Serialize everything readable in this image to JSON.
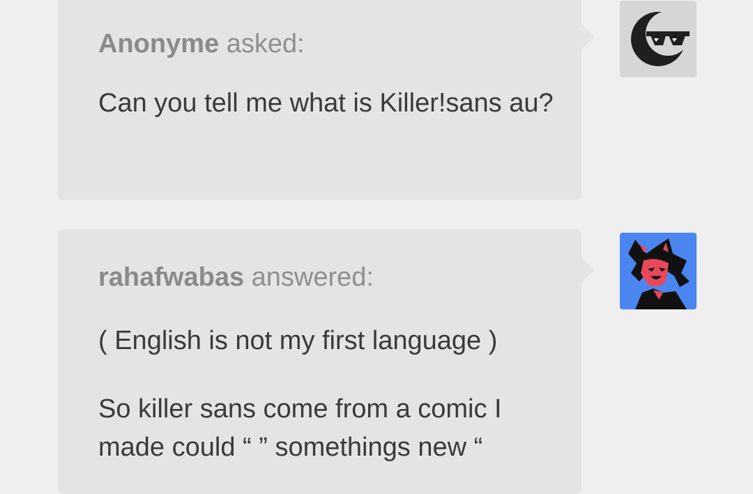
{
  "ask": {
    "asker_name": "Anonyme",
    "verb": "asked:",
    "question": "Can you tell me what is Killer!sans au?",
    "avatar_icon": "sunglasses-moon-icon"
  },
  "answer": {
    "answerer_name": "rahafwabas",
    "verb": "answered:",
    "paragraphs": [
      "( English is not my first language )",
      "So killer sans come from a comic I made could “ ” somethings new “"
    ],
    "avatar_icon": "cat-character-avatar"
  },
  "colors": {
    "page_bg": "#efefef",
    "bubble_bg": "#e4e4e4",
    "avatar_bg_blue": "#4b86f0"
  }
}
